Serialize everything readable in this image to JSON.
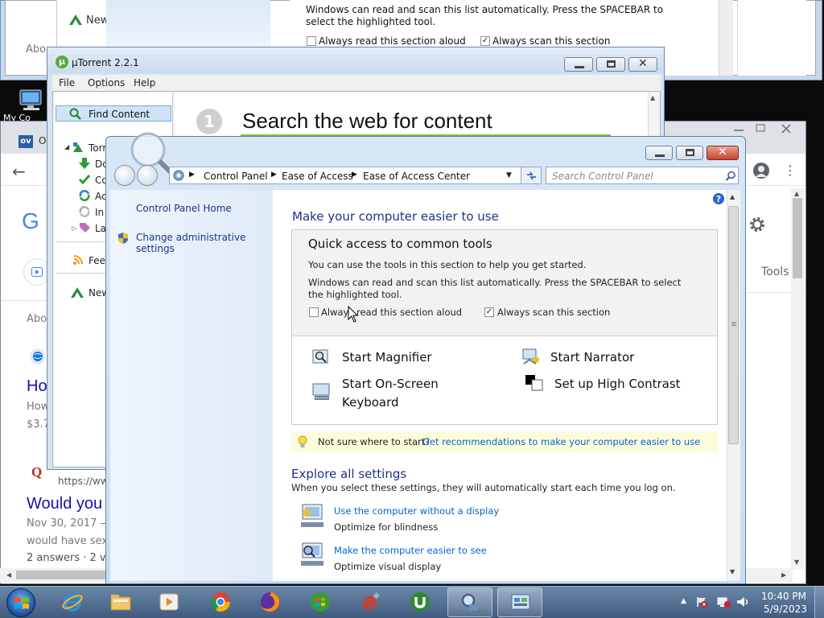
{
  "background_window": {
    "left_texts": [
      "New",
      "Abo"
    ],
    "instruction": "Windows can read and scan this list automatically.  Press the SPACEBAR to select the highlighted tool.",
    "checkbox_read": "Always read this section aloud",
    "checkbox_scan": "Always scan this section"
  },
  "desktop": {
    "icon_partial_label": "My Co"
  },
  "chrome": {
    "tab_favicon": "ov",
    "tab_title": "O",
    "settings_icon": "gear-icon",
    "tools_label": "Tools",
    "google_letter": "G",
    "results": {
      "about": "Abo",
      "title_partial": "Ho",
      "snippet_line1": "How",
      "snippet_line2": "$3.7",
      "quora_url": "https://www",
      "title2": "Would you",
      "date": "Nov 30, 2017 —",
      "snippet2": "would have sex",
      "answers": "2 answers · 2 vo"
    }
  },
  "utorrent": {
    "title": "µTorrent 2.2.1",
    "menu": [
      "File",
      "Options",
      "Help"
    ],
    "find_content": "Find Content",
    "sidebar": [
      "Torr",
      "Do",
      "Co",
      "Ac",
      "In",
      "La",
      "Feed",
      "New"
    ],
    "step_number": "1",
    "search_title": "Search the web for content"
  },
  "ease_of_access": {
    "breadcrumb": [
      "Control Panel",
      "Ease of Access",
      "Ease of Access Center"
    ],
    "search_placeholder": "Search Control Panel",
    "left_nav": {
      "home": "Control Panel Home",
      "admin": "Change administrative settings"
    },
    "heading": "Make your computer easier to use",
    "quick_access": {
      "title": "Quick access to common tools",
      "desc": "You can use the tools in this section to help you get started.",
      "instruction": "Windows can read and scan this list automatically.  Press the SPACEBAR to select the highlighted tool.",
      "checkbox_read": "Always read this section aloud",
      "checkbox_read_checked": false,
      "checkbox_scan": "Always scan this section",
      "checkbox_scan_checked": true
    },
    "tools": {
      "magnifier": "Start Magnifier",
      "narrator": "Start Narrator",
      "osk_line1": "Start On-Screen",
      "osk_line2": "Keyboard",
      "contrast": "Set up High Contrast"
    },
    "tip": {
      "prefix": "Not sure where to start?",
      "link": "Get recommendations to make your computer easier to use"
    },
    "explore": {
      "title": "Explore all settings",
      "desc": "When you select these settings, they will automatically start each time you log on.",
      "items": [
        {
          "link": "Use the computer without a display",
          "desc": "Optimize for blindness"
        },
        {
          "link": "Make the computer easier to see",
          "desc": "Optimize visual display"
        }
      ]
    }
  },
  "taskbar": {
    "apps": [
      "internet-explorer",
      "file-explorer",
      "media-player",
      "chrome",
      "firefox",
      "windows-media-center",
      "ccleaner",
      "utorrent",
      "magnifier",
      "control-panel"
    ],
    "active": [
      "magnifier",
      "control-panel"
    ],
    "time": "10:40 PM",
    "date": "5/9/2023"
  }
}
